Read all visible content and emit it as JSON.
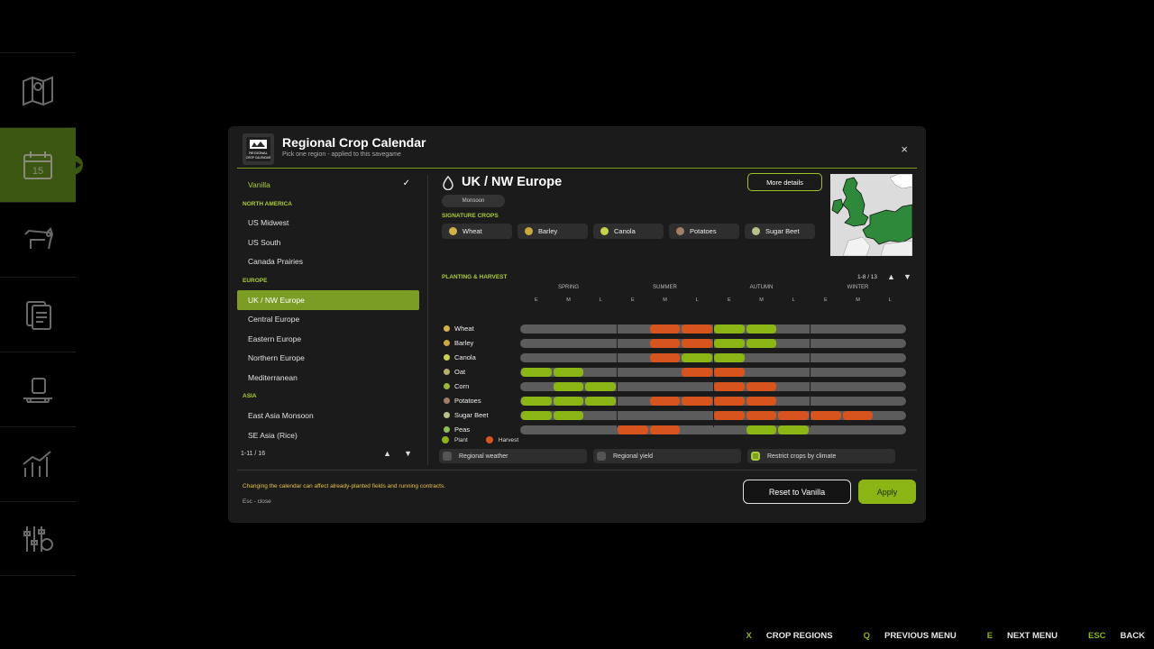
{
  "dialog": {
    "title": "Regional Crop Calendar",
    "subtitle": "Pick one region - applied to this savegame",
    "close_label": "×",
    "logo_text": "REGIONAL CROP CALENDAR"
  },
  "region_list": {
    "vanilla_label": "Vanilla",
    "check": "✓",
    "groups": [
      {
        "name": "NORTH AMERICA",
        "items": [
          "US Midwest",
          "US South",
          "Canada Prairies"
        ]
      },
      {
        "name": "EUROPE",
        "items": [
          "UK / NW Europe",
          "Central Europe",
          "Eastern Europe",
          "Northern Europe",
          "Mediterranean"
        ]
      },
      {
        "name": "ASIA",
        "items": [
          "East Asia Monsoon",
          "SE Asia (Rice)"
        ]
      }
    ],
    "selected": "UK / NW Europe",
    "pagination": "1-11 / 16",
    "up_arrow": "▲",
    "down_arrow": "▼"
  },
  "detail": {
    "region_title": "UK / NW Europe",
    "climate": "Monsoon",
    "more_details": "More details",
    "signature_label": "SIGNATURE CROPS",
    "signature_crops": [
      {
        "name": "Wheat",
        "color": "#d4b04a"
      },
      {
        "name": "Barley",
        "color": "#c9a840"
      },
      {
        "name": "Canola",
        "color": "#c8d24a"
      },
      {
        "name": "Potatoes",
        "color": "#a07e68"
      },
      {
        "name": "Sugar Beet",
        "color": "#b7c28a"
      }
    ],
    "planting_label": "PLANTING & HARVEST",
    "planting_count": "1-8 / 13",
    "up_arrow": "▲",
    "down_arrow": "▼"
  },
  "calendar": {
    "seasons": [
      "SPRING",
      "SUMMER",
      "AUTUMN",
      "WINTER"
    ],
    "periods": [
      "E",
      "M",
      "L",
      "E",
      "M",
      "L",
      "E",
      "M",
      "L",
      "E",
      "M",
      "L"
    ],
    "colors": {
      "plant": "#8ab514",
      "harvest": "#d8541e",
      "track": "#5c5c5c"
    },
    "crops": [
      {
        "name": "Wheat",
        "icon_color": "#d4b04a",
        "plant": [
          6,
          7
        ],
        "harvest": [
          4,
          5
        ]
      },
      {
        "name": "Barley",
        "icon_color": "#c9a840",
        "plant": [
          6,
          7
        ],
        "harvest": [
          4,
          5
        ]
      },
      {
        "name": "Canola",
        "icon_color": "#c8d24a",
        "plant": [
          5,
          6
        ],
        "harvest": [
          4
        ]
      },
      {
        "name": "Oat",
        "icon_color": "#b5b06a",
        "plant": [
          0,
          1
        ],
        "harvest": [
          5,
          6
        ]
      },
      {
        "name": "Corn",
        "icon_color": "#9ab73a",
        "plant": [
          1,
          2
        ],
        "harvest": [
          6,
          7
        ]
      },
      {
        "name": "Potatoes",
        "icon_color": "#a07e68",
        "plant": [
          0,
          1,
          2
        ],
        "harvest": [
          4,
          5,
          6,
          7
        ]
      },
      {
        "name": "Sugar Beet",
        "icon_color": "#b7c28a",
        "plant": [
          0,
          1
        ],
        "harvest": [
          6,
          7,
          8,
          9,
          10
        ]
      },
      {
        "name": "Peas",
        "icon_color": "#8fbf5a",
        "plant": [
          7,
          8
        ],
        "harvest": [
          3,
          4
        ]
      }
    ]
  },
  "legend": {
    "plant": "Plant",
    "harvest": "Harvest"
  },
  "toggles": [
    {
      "label": "Regional weather",
      "on": false
    },
    {
      "label": "Regional yield",
      "on": false
    },
    {
      "label": "Restrict crops by climate",
      "on": true
    }
  ],
  "footer": {
    "warning": "Changing the calendar can affect already-planted fields and running contracts.",
    "esc_hint": "Esc - close",
    "reset_label": "Reset to Vanilla",
    "apply_label": "Apply"
  },
  "hints": [
    {
      "key": "X",
      "label": "CROP REGIONS"
    },
    {
      "key": "Q",
      "label": "PREVIOUS MENU"
    },
    {
      "key": "E",
      "label": "NEXT MENU"
    },
    {
      "key": "ESC",
      "label": "BACK"
    }
  ],
  "sidenav": {
    "items": [
      "map-icon",
      "calendar-icon",
      "animals-icon",
      "contracts-icon",
      "production-icon",
      "statistics-icon",
      "settings-icon"
    ],
    "active_index": 1,
    "calendar_day": "15"
  },
  "accent": "#8ab514"
}
